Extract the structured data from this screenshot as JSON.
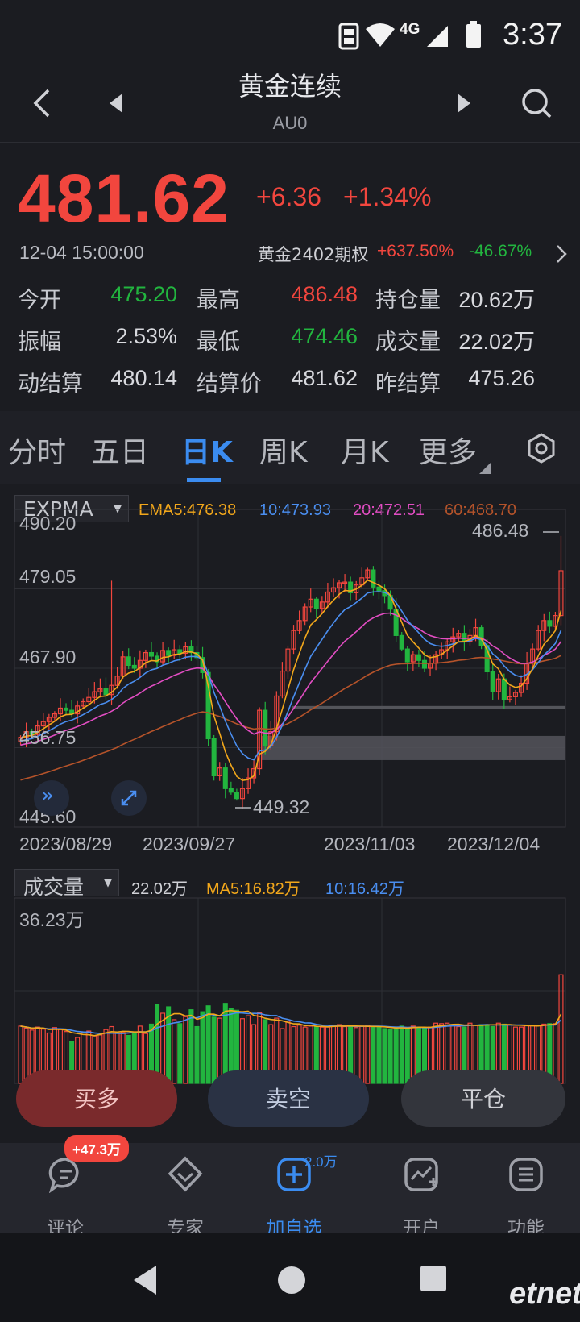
{
  "status_bar": {
    "time": "3:37",
    "network": "4G"
  },
  "header": {
    "title": "黄金连续",
    "code": "AU0"
  },
  "quote": {
    "price": "481.62",
    "change": "+6.36",
    "change_pct": "+1.34%",
    "datetime": "12-04 15:00:00",
    "option_name": "黄金2402期权",
    "option_up": "+637.50%",
    "option_down": "-46.67%"
  },
  "stats": [
    [
      {
        "label": "今开",
        "value": "475.20",
        "color": "green"
      },
      {
        "label": "最高",
        "value": "486.48",
        "color": "red"
      },
      {
        "label": "持仓量",
        "value": "20.62万",
        "color": "white"
      }
    ],
    [
      {
        "label": "振幅",
        "value": "2.53%",
        "color": "white"
      },
      {
        "label": "最低",
        "value": "474.46",
        "color": "green"
      },
      {
        "label": "成交量",
        "value": "22.02万",
        "color": "white"
      }
    ],
    [
      {
        "label": "动结算",
        "value": "480.14",
        "color": "white"
      },
      {
        "label": "结算价",
        "value": "481.62",
        "color": "white"
      },
      {
        "label": "昨结算",
        "value": "475.26",
        "color": "white"
      }
    ]
  ],
  "tabs": [
    "分时",
    "五日",
    "日K",
    "周K",
    "月K",
    "更多"
  ],
  "active_tab": "日K",
  "indicator": {
    "name": "EXPMA",
    "ema5": "EMA5:476.38",
    "ema10": "10:473.93",
    "ema20": "20:472.51",
    "ema60": "60:468.70"
  },
  "chart_data": [
    {
      "type": "candlestick",
      "y_ticks": [
        "490.20",
        "479.05",
        "467.90",
        "456.75",
        "445.60"
      ],
      "x_labels": [
        "2023/08/29",
        "2023/09/27",
        "2023/11/03",
        "2023/12/04"
      ],
      "annotations": {
        "high": "486.48",
        "low": "449.32"
      },
      "ylim": [
        445.6,
        490.2
      ],
      "colors": {
        "up": "#f2463e",
        "down": "#22b53f",
        "ema5": "#f2a71b",
        "ema10": "#4a8ef0",
        "ema20": "#e24dc3",
        "ema60": "#b5532a"
      },
      "closes": [
        458.2,
        459.0,
        458.6,
        459.8,
        460.4,
        461.0,
        461.5,
        462.3,
        462.0,
        461.5,
        462.6,
        463.2,
        463.8,
        464.6,
        465.0,
        464.2,
        465.5,
        466.8,
        469.5,
        468.3,
        467.9,
        469.0,
        470.1,
        469.6,
        468.8,
        470.4,
        469.7,
        470.5,
        470.0,
        470.9,
        470.1,
        469.4,
        467.3,
        458.0,
        452.8,
        453.9,
        451.0,
        450.5,
        449.6,
        451.0,
        452.5,
        453.8,
        462.0,
        457.0,
        459.0,
        464.0,
        467.5,
        470.6,
        473.2,
        474.6,
        476.5,
        477.6,
        476.3,
        477.2,
        478.6,
        479.2,
        479.9,
        480.0,
        478.5,
        479.6,
        480.6,
        481.7,
        479.3,
        478.8,
        478.1,
        476.2,
        472.5,
        470.6,
        468.8,
        469.8,
        469.0,
        467.9,
        468.6,
        469.8,
        470.5,
        471.6,
        472.3,
        472.8,
        471.7,
        472.5,
        473.6,
        471.1,
        467.4,
        464.6,
        466.4,
        463.5,
        463.9,
        464.5,
        465.8,
        468.6,
        470.6,
        473.2,
        474.6,
        473.8,
        475.3,
        481.6
      ]
    },
    {
      "type": "bar",
      "label": "成交量",
      "current": "22.02万",
      "ma5": "MA5:16.82万",
      "ma10": "10:16.42万",
      "ymax_label": "36.23万",
      "ymax": 36.23,
      "values": [
        11.6,
        11.2,
        10.8,
        11.4,
        11.0,
        10.2,
        11.3,
        10.9,
        10.5,
        8.5,
        9.3,
        10.3,
        10.6,
        9.6,
        9.8,
        10.9,
        11.5,
        10.2,
        10.3,
        9.7,
        10.4,
        11.6,
        10.1,
        12.0,
        15.9,
        14.2,
        15.5,
        12.9,
        12.1,
        13.5,
        14.9,
        11.5,
        14.5,
        15.7,
        13.4,
        13.2,
        16.2,
        15.2,
        14.8,
        13.1,
        13.7,
        11.9,
        14.3,
        12.9,
        11.9,
        13.2,
        11.1,
        12.6,
        11.5,
        11.8,
        11.4,
        11.6,
        11.5,
        11.4,
        11.4,
        11.8,
        11.9,
        11.5,
        11.6,
        11.3,
        11.6,
        11.8,
        11.4,
        11.4,
        11.1,
        10.9,
        11.3,
        11.6,
        11.1,
        11.6,
        11.3,
        11.3,
        11.4,
        12.2,
        12.1,
        12.2,
        11.8,
        11.5,
        11.4,
        12.2,
        11.8,
        11.9,
        11.9,
        11.5,
        12.2,
        12.0,
        11.9,
        11.4,
        11.4,
        11.8,
        11.8,
        11.8,
        12.0,
        12.1,
        12.1,
        22.0
      ],
      "up_flags": [
        1,
        1,
        1,
        1,
        1,
        1,
        1,
        1,
        1,
        0,
        1,
        1,
        1,
        1,
        1,
        1,
        1,
        1,
        1,
        0,
        0,
        1,
        1,
        0,
        0,
        1,
        0,
        1,
        0,
        1,
        0,
        0,
        0,
        0,
        0,
        1,
        0,
        0,
        0,
        1,
        1,
        1,
        1,
        0,
        1,
        1,
        1,
        1,
        1,
        1,
        1,
        1,
        0,
        1,
        1,
        1,
        1,
        1,
        0,
        1,
        1,
        1,
        0,
        0,
        0,
        0,
        0,
        0,
        0,
        1,
        0,
        0,
        1,
        1,
        1,
        1,
        1,
        1,
        0,
        1,
        1,
        0,
        0,
        0,
        1,
        0,
        1,
        1,
        1,
        1,
        1,
        1,
        1,
        0,
        1,
        1
      ]
    }
  ],
  "action_buttons": [
    "买多",
    "卖空",
    "平仓"
  ],
  "bottom_nav": [
    {
      "label": "评论",
      "icon": "comment-icon",
      "badge": "+47.3万"
    },
    {
      "label": "专家",
      "icon": "expert-icon"
    },
    {
      "label": "加自选",
      "icon": "add-favorite-icon",
      "badge": "2.0万"
    },
    {
      "label": "开户",
      "icon": "open-account-icon"
    },
    {
      "label": "功能",
      "icon": "menu-icon"
    }
  ],
  "watermark": "etnet"
}
